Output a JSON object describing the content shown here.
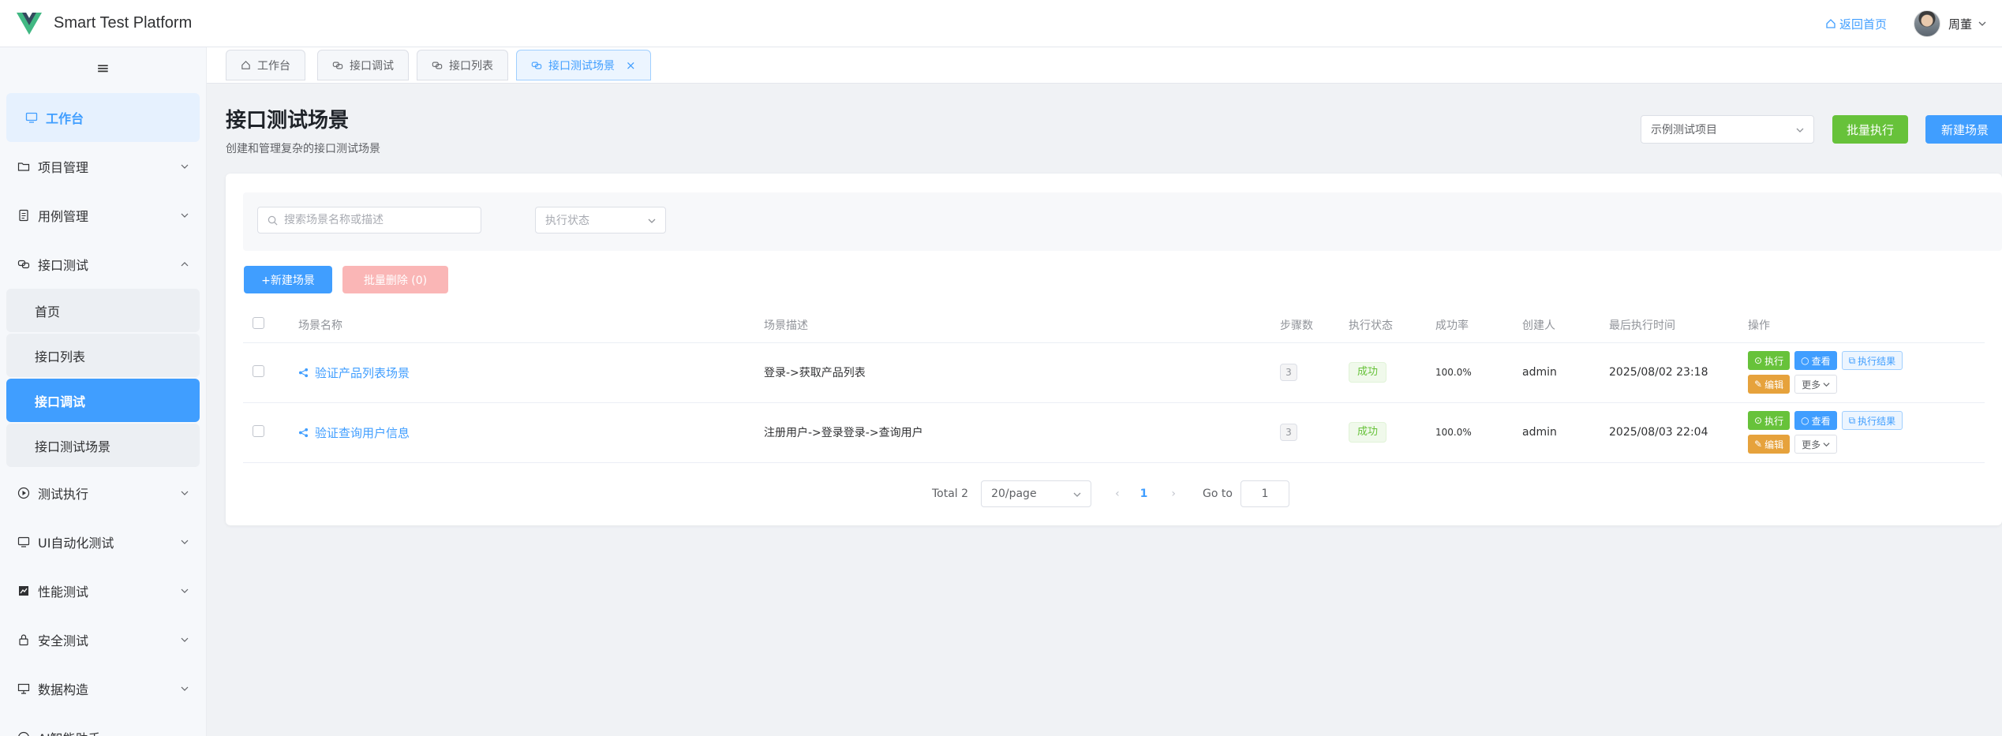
{
  "header": {
    "brand": "Smart Test Platform",
    "home_link": "返回首页",
    "username": "周董"
  },
  "sidebar": {
    "toggle_icon": "hamburger-icon",
    "workbench": "工作台",
    "items": [
      {
        "label": "项目管理",
        "icon": "folder-icon"
      },
      {
        "label": "用例管理",
        "icon": "document-icon"
      },
      {
        "label": "接口测试",
        "icon": "link-icon",
        "expanded": true
      },
      {
        "label": "测试执行",
        "icon": "play-icon"
      },
      {
        "label": "UI自动化测试",
        "icon": "monitor-icon"
      },
      {
        "label": "性能测试",
        "icon": "chart-icon"
      },
      {
        "label": "安全测试",
        "icon": "lock-icon"
      },
      {
        "label": "数据构造",
        "icon": "presentation-icon"
      },
      {
        "label": "AI智能助手",
        "icon": "chat-icon"
      }
    ],
    "submenu": [
      "首页",
      "接口列表",
      "接口调试",
      "接口测试场景"
    ],
    "active_submenu": "接口调试"
  },
  "tabs": [
    {
      "label": "工作台",
      "icon": "home-icon"
    },
    {
      "label": "接口调试",
      "icon": "link-icon"
    },
    {
      "label": "接口列表",
      "icon": "link-icon"
    },
    {
      "label": "接口测试场景",
      "icon": "link-icon",
      "active": true
    }
  ],
  "page": {
    "title": "接口测试场景",
    "subtitle": "创建和管理复杂的接口测试场景",
    "project_select": "示例测试项目",
    "batch_execute": "批量执行",
    "new_scene": "新建场景"
  },
  "filters": {
    "search_placeholder": "搜索场景名称或描述",
    "status_placeholder": "执行状态"
  },
  "actions": {
    "new_scene": "+新建场景",
    "batch_delete": "批量删除 (0)"
  },
  "table": {
    "columns": [
      "场景名称",
      "场景描述",
      "步骤数",
      "执行状态",
      "成功率",
      "创建人",
      "最后执行时间",
      "操作"
    ],
    "rows": [
      {
        "name": "验证产品列表场景",
        "desc": "登录->获取产品列表",
        "steps": "3",
        "status": "成功",
        "rate": "100.0%",
        "creator": "admin",
        "last_run": "2025/08/02 23:18"
      },
      {
        "name": "验证查询用户信息",
        "desc": "注册用户->登录登录->查询用户",
        "steps": "3",
        "status": "成功",
        "rate": "100.0%",
        "creator": "admin",
        "last_run": "2025/08/03 22:04"
      }
    ],
    "op_labels": {
      "exec": "执行",
      "view": "查看",
      "result": "执行结果",
      "edit": "编辑",
      "more": "更多"
    }
  },
  "pagination": {
    "total": "Total 2",
    "page_size": "20/page",
    "current": "1",
    "goto_label": "Go to",
    "goto_value": "1"
  },
  "colors": {
    "primary": "#409eff",
    "success": "#67c23a",
    "warning": "#e6a23c",
    "danger_light": "#fab6b6"
  }
}
